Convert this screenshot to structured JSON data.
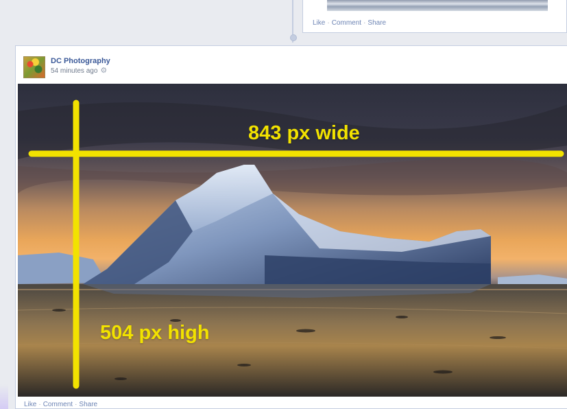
{
  "top_post": {
    "actions": {
      "like": "Like",
      "comment": "Comment",
      "share": "Share",
      "separator": "·"
    }
  },
  "post": {
    "author": "DC Photography",
    "timestamp": "54 minutes ago",
    "privacy_icon": "gear-icon",
    "photo_description_icon": "iceberg-photo",
    "actions": {
      "like": "Like",
      "comment": "Comment",
      "share": "Share",
      "separator": "·"
    }
  },
  "annotations": {
    "width_label": "843 px wide",
    "height_label": "504 px high",
    "color": "#f2e200"
  },
  "colors": {
    "link": "#6d84b4",
    "author": "#3b5998",
    "border": "#c4cde0",
    "background": "#e9ebf0"
  }
}
